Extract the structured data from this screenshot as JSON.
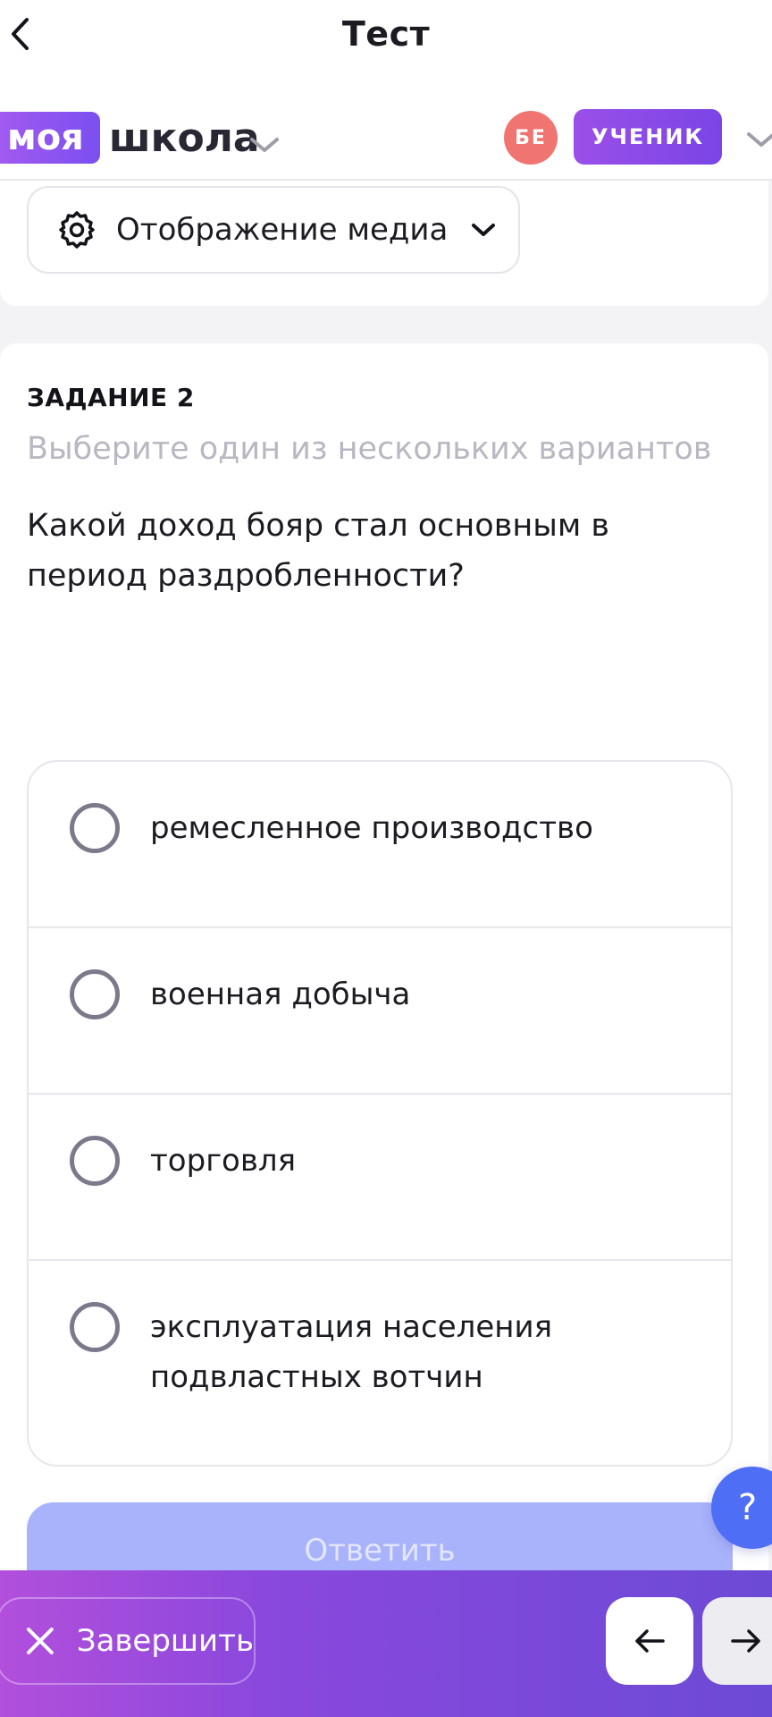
{
  "topbar": {
    "title": "Тест",
    "back_icon": "chevron-left-icon"
  },
  "school": {
    "logo_part1": "моя",
    "logo_part2": "школа",
    "avatar_initials": "БЕ",
    "role": "УЧЕНИК",
    "accent_color": "#8a4ff0",
    "avatar_color": "#f0746f"
  },
  "media": {
    "label": "Отображение медиа",
    "icon": "gear-icon"
  },
  "task": {
    "number": "ЗАДАНИЕ 2",
    "hint": "Выберите один из нескольких вариантов",
    "question": "Какой доход бояр стал основным в период раздробленности?",
    "options": [
      {
        "text": "ремесленное производство",
        "selected": false
      },
      {
        "text": "военная добыча",
        "selected": false
      },
      {
        "text": "торговля",
        "selected": false
      },
      {
        "text": "эксплуатация населения подвластных вотчин",
        "selected": false
      }
    ],
    "submit_label": "Ответить"
  },
  "help": {
    "label": "?"
  },
  "bottom_bar": {
    "finish_label": "Завершить",
    "prev_icon": "arrow-left-icon",
    "next_icon": "arrow-right-icon"
  }
}
